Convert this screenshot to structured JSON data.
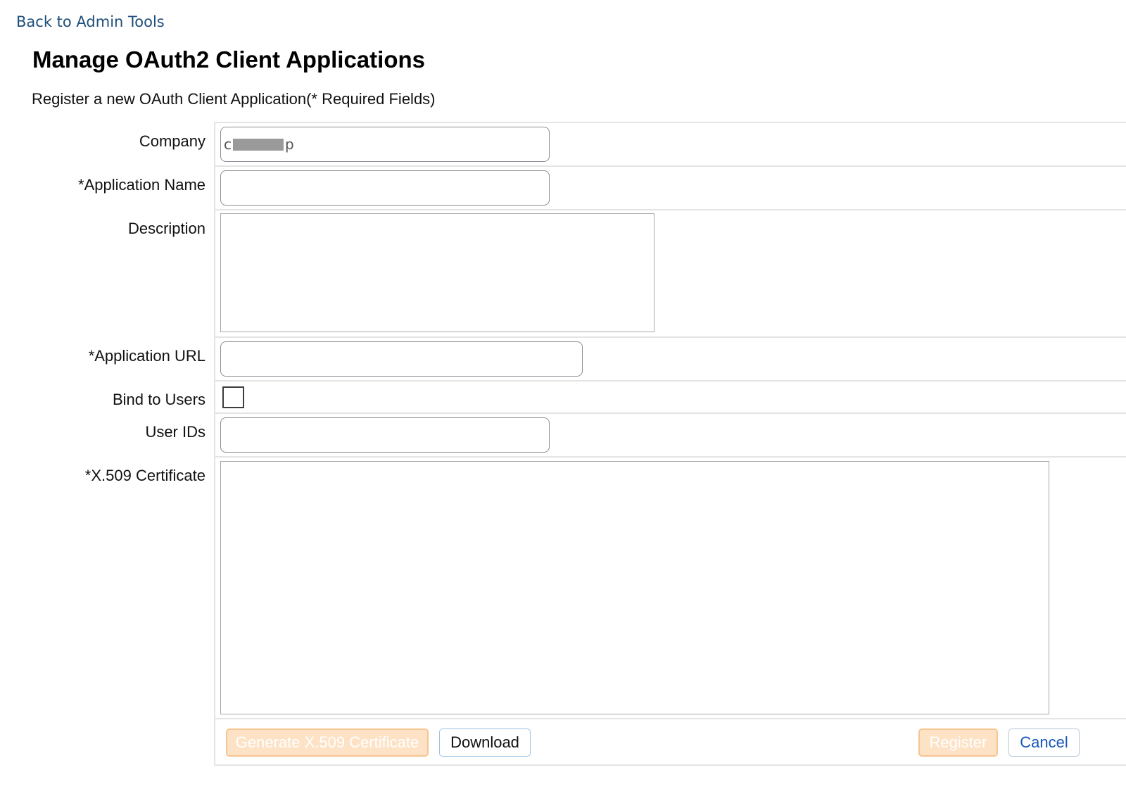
{
  "nav": {
    "back_link": "Back to Admin Tools"
  },
  "header": {
    "title": "Manage OAuth2 Client Applications",
    "subtitle": "Register a new OAuth Client Application(* Required Fields)"
  },
  "form": {
    "company": {
      "label": "Company",
      "value_prefix": "c",
      "value_suffix": "p"
    },
    "application_name": {
      "label": "*Application Name",
      "value": ""
    },
    "description": {
      "label": "Description",
      "value": ""
    },
    "application_url": {
      "label": "*Application URL",
      "value": ""
    },
    "bind_to_users": {
      "label": "Bind to Users",
      "checked": false
    },
    "user_ids": {
      "label": "User IDs",
      "value": ""
    },
    "certificate": {
      "label": "*X.509 Certificate",
      "value": ""
    }
  },
  "actions": {
    "generate_label": "Generate X.509 Certificate",
    "download_label": "Download",
    "register_label": "Register",
    "cancel_label": "Cancel"
  },
  "colors": {
    "link": "#1f4f7a",
    "disabled_button_bg": "#fde2c6",
    "disabled_button_border": "#f5c592",
    "cancel_text": "#1756b8"
  }
}
